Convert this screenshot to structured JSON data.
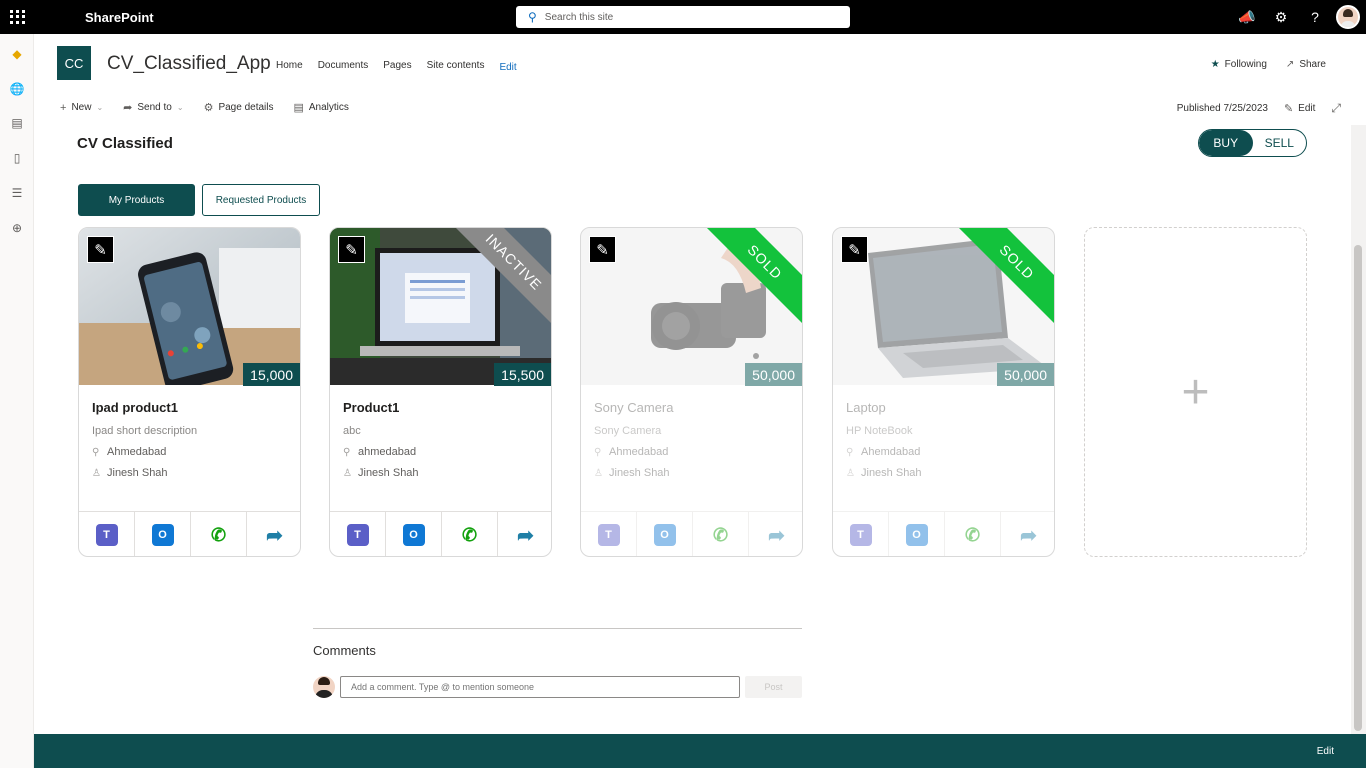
{
  "suitebar": {
    "app_name": "SharePoint",
    "search_placeholder": "Search this site"
  },
  "site": {
    "logo_initials": "CC",
    "title": "CV_Classified_App",
    "nav": [
      "Home",
      "Documents",
      "Pages",
      "Site contents"
    ],
    "nav_edit": "Edit",
    "following_label": "Following",
    "share_label": "Share"
  },
  "commandbar": {
    "new_label": "New",
    "send_to_label": "Send to",
    "page_details_label": "Page details",
    "analytics_label": "Analytics",
    "published": "Published 7/25/2023",
    "edit_label": "Edit"
  },
  "page": {
    "title": "CV Classified",
    "toggle": {
      "buy": "BUY",
      "sell": "SELL",
      "selected": "BUY"
    },
    "tabs": {
      "my_products": "My Products",
      "requested_products": "Requested Products"
    }
  },
  "products": [
    {
      "name": "Ipad product1",
      "description": "Ipad short description",
      "location": "Ahmedabad",
      "seller": "Jinesh Shah",
      "price": "15,000",
      "status": ""
    },
    {
      "name": "Product1",
      "description": "abc",
      "location": "ahmedabad",
      "seller": "Jinesh Shah",
      "price": "15,500",
      "status": "INACTIVE"
    },
    {
      "name": "Sony Camera",
      "description": "Sony Camera",
      "location": "Ahmedabad",
      "seller": "Jinesh Shah",
      "price": "50,000",
      "status": "SOLD"
    },
    {
      "name": "Laptop",
      "description": "HP NoteBook",
      "location": "Ahemdabad",
      "seller": "Jinesh Shah",
      "price": "50,000",
      "status": "SOLD"
    }
  ],
  "comments": {
    "title": "Comments",
    "placeholder": "Add a comment. Type @ to mention someone",
    "post_label": "Post"
  },
  "footer": {
    "edit_label": "Edit"
  },
  "colors": {
    "brand": "#0e4d4f",
    "sold": "#13c23c",
    "inactive": "#8a8a8a"
  }
}
